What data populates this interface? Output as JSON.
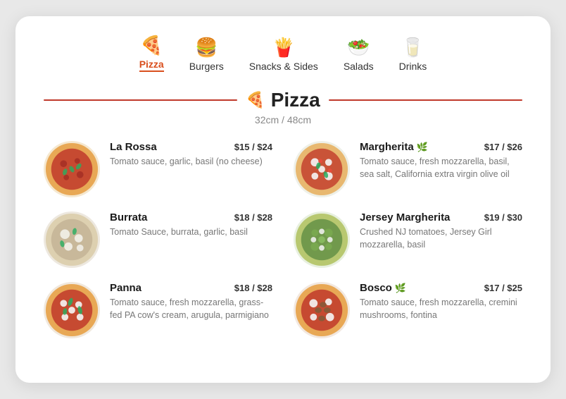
{
  "nav": {
    "items": [
      {
        "id": "pizza",
        "label": "Pizza",
        "icon": "🍕",
        "active": true
      },
      {
        "id": "burgers",
        "label": "Burgers",
        "icon": "🍔",
        "active": false
      },
      {
        "id": "snacks",
        "label": "Snacks & Sides",
        "icon": "🍟",
        "active": false
      },
      {
        "id": "salads",
        "label": "Salads",
        "icon": "🥗",
        "active": false
      },
      {
        "id": "drinks",
        "label": "Drinks",
        "icon": "🥛",
        "active": false
      }
    ]
  },
  "section": {
    "title": "Pizza",
    "subtitle": "32cm / 48cm"
  },
  "menu_items": [
    {
      "id": "la-rossa",
      "name": "La Rossa",
      "badge": "",
      "description": "Tomato sauce, garlic, basil (no cheese)",
      "price": "$15 / $24",
      "color_class": "pizza-bg-1"
    },
    {
      "id": "margherita",
      "name": "Margherita",
      "badge": "🌿",
      "description": "Tomato sauce, fresh mozzarella, basil, sea salt, California extra virgin olive oil",
      "price": "$17 / $26",
      "color_class": "pizza-bg-2"
    },
    {
      "id": "burrata",
      "name": "Burrata",
      "badge": "",
      "description": "Tomato Sauce, burrata, garlic, basil",
      "price": "$18 / $28",
      "color_class": "pizza-bg-3"
    },
    {
      "id": "jersey-margherita",
      "name": "Jersey Margherita",
      "badge": "",
      "description": "Crushed NJ tomatoes, Jersey Girl mozzarella, basil",
      "price": "$19 / $30",
      "color_class": "pizza-bg-4"
    },
    {
      "id": "panna",
      "name": "Panna",
      "badge": "",
      "description": "Tomato sauce, fresh mozzarella, grass-fed PA cow's cream, arugula, parmigiano",
      "price": "$18 / $28",
      "color_class": "pizza-bg-5"
    },
    {
      "id": "bosco",
      "name": "Bosco",
      "badge": "🌿",
      "description": "Tomato sauce, fresh mozzarella, cremini mushrooms, fontina",
      "price": "$17 / $25",
      "color_class": "pizza-bg-6"
    }
  ]
}
